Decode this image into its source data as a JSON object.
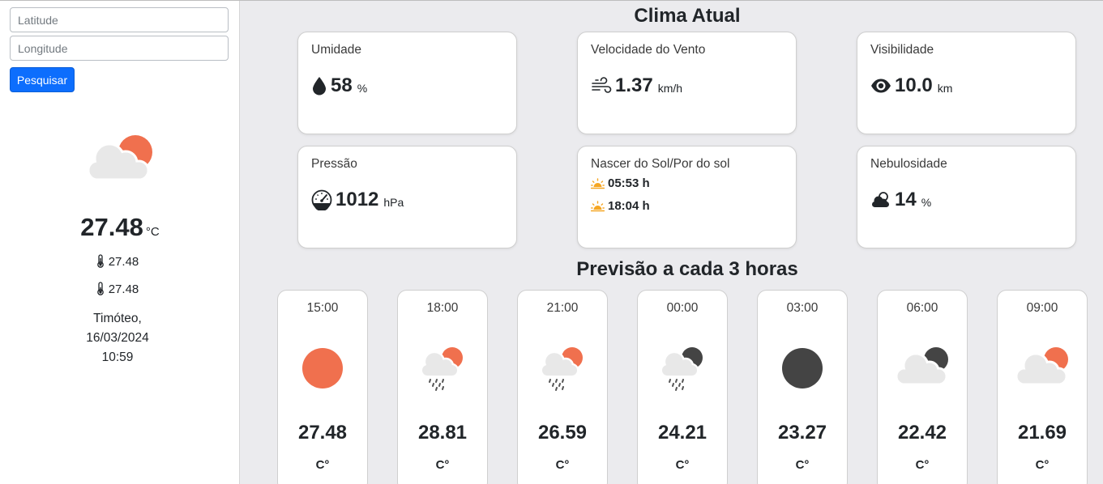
{
  "search": {
    "latitude_placeholder": "Latitude",
    "longitude_placeholder": "Longitude",
    "button_label": "Pesquisar"
  },
  "current_summary": {
    "icon": "partly-cloudy-day-icon",
    "temperature": "27.48",
    "unit": "°C",
    "temp_max": "27.48",
    "temp_min": "27.48",
    "city": "Timóteo,",
    "date": "16/03/2024",
    "time": "10:59"
  },
  "colors": {
    "sun": "#f0704e",
    "moon": "#444444",
    "cloud": "#e8e8e8",
    "accent": "#0d6efd",
    "sunrise": "#f5a623"
  },
  "current": {
    "title": "Clima Atual",
    "humidity": {
      "label": "Umidade",
      "icon": "droplet-icon",
      "value": "58",
      "unit": "%"
    },
    "wind": {
      "label": "Velocidade do Vento",
      "icon": "wind-icon",
      "value": "1.37",
      "unit": "km/h"
    },
    "visibility": {
      "label": "Visibilidade",
      "icon": "eye-icon",
      "value": "10.0",
      "unit": "km"
    },
    "pressure": {
      "label": "Pressão",
      "icon": "gauge-icon",
      "value": "1012",
      "unit": "hPa"
    },
    "sun": {
      "label": "Nascer do Sol/Por do sol",
      "icon": "sunrise-icon",
      "sunrise": "05:53 h",
      "sunset": "18:04 h"
    },
    "cloudiness": {
      "label": "Nebulosidade",
      "icon": "cloud-sun-icon",
      "value": "14",
      "unit": "%"
    }
  },
  "forecast": {
    "title": "Previsão a cada 3 horas",
    "unit": "C°",
    "items": [
      {
        "time": "15:00",
        "temp": "27.48",
        "icon": "sun-icon"
      },
      {
        "time": "18:00",
        "temp": "28.81",
        "icon": "rain-cloud-sun-icon"
      },
      {
        "time": "21:00",
        "temp": "26.59",
        "icon": "rain-cloud-sun-icon"
      },
      {
        "time": "00:00",
        "temp": "24.21",
        "icon": "rain-cloud-moon-icon"
      },
      {
        "time": "03:00",
        "temp": "23.27",
        "icon": "moon-icon"
      },
      {
        "time": "06:00",
        "temp": "22.42",
        "icon": "cloud-moon-icon"
      },
      {
        "time": "09:00",
        "temp": "21.69",
        "icon": "cloud-sun-icon"
      }
    ]
  }
}
